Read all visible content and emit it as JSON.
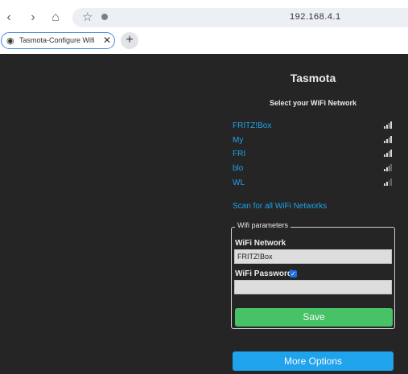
{
  "browser": {
    "url": "192.168.4.1",
    "tab_title": "Tasmota-Configure Wifi",
    "tab_icon": "tasmota-icon",
    "new_tab_label": "+"
  },
  "page": {
    "title": "Tasmota",
    "subtitle": "Select your WiFi Network",
    "networks": [
      {
        "name": "FRITZ!Box",
        "signal": 4
      },
      {
        "name": "My",
        "signal": 4
      },
      {
        "name": "FRI",
        "signal": 4
      },
      {
        "name": "blo",
        "signal": 3
      },
      {
        "name": "WL",
        "signal": 2
      }
    ],
    "scan_link": "Scan for all WiFi Networks",
    "wifi_params": {
      "legend": "Wifi parameters",
      "network_label": "WiFi Network",
      "network_value": "FRITZ!Box",
      "password_label": "WiFi Password",
      "password_value": "",
      "show_password_checked": true,
      "save_label": "Save"
    },
    "more_options": "More Options"
  },
  "colors": {
    "link": "#1fa3ec",
    "save_button": "#47c266",
    "background": "#252525"
  }
}
